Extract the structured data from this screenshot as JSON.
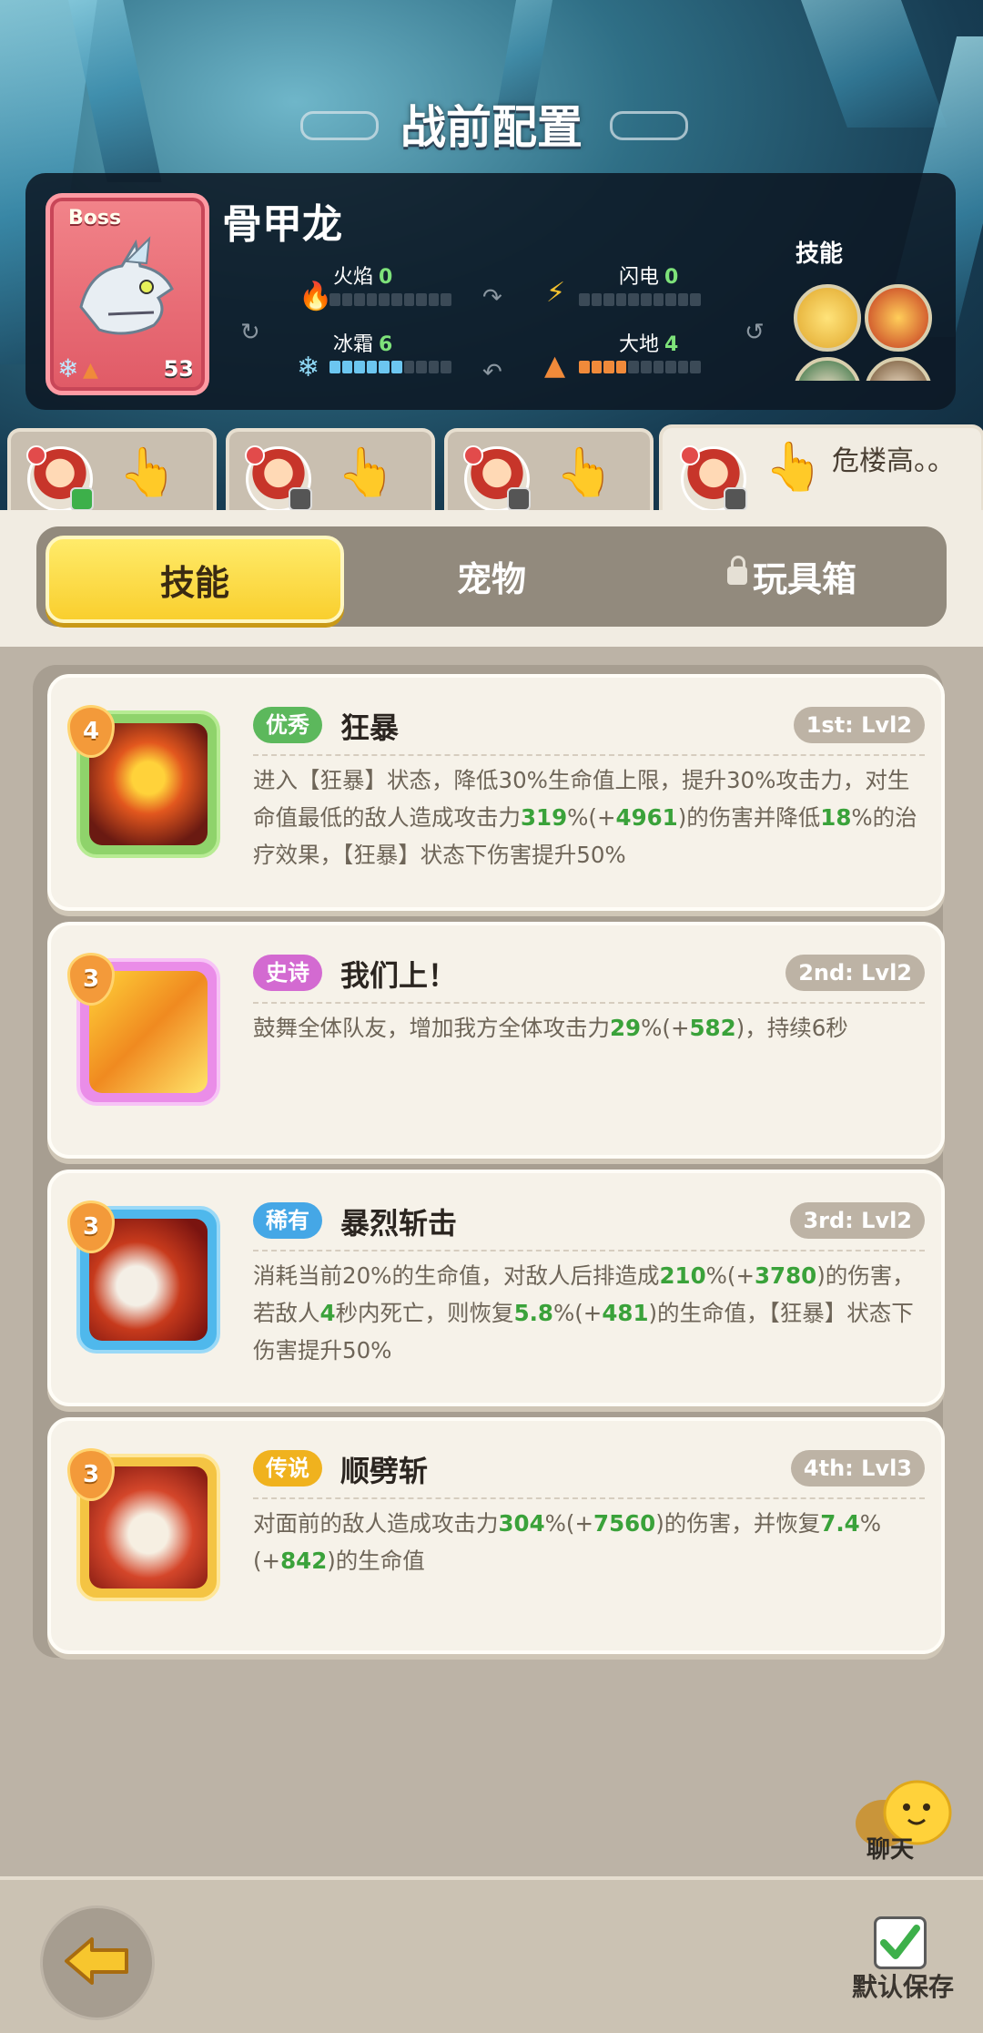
{
  "header": {
    "title": "战前配置"
  },
  "boss": {
    "tag": "Boss",
    "name": "骨甲龙",
    "level": "53",
    "stats": [
      {
        "label": "火焰",
        "value": "0"
      },
      {
        "label": "闪电",
        "value": "0"
      },
      {
        "label": "冰霜",
        "value": "6"
      },
      {
        "label": "大地",
        "value": "4"
      }
    ],
    "skills_label": "技能"
  },
  "team_tabs": [
    {
      "name": ""
    },
    {
      "name": ""
    },
    {
      "name": ""
    },
    {
      "name": "危楼高。。"
    }
  ],
  "segments": {
    "skills": "技能",
    "pets": "宠物",
    "toybox": "玩具箱"
  },
  "skills": [
    {
      "level": "4",
      "rarity": "优秀",
      "name": "狂暴",
      "rank": "1st: Lvl2",
      "desc": [
        "进入【狂暴】状态，降低30%生命值上限，提升30%攻击力，对生命值最低的敌人造成攻击力",
        "319",
        "%(+",
        "4961",
        ")的伤害并降低",
        "18",
        "%的治疗效果，【狂暴】状态下伤害提升50%"
      ]
    },
    {
      "level": "3",
      "rarity": "史诗",
      "name": "我们上！",
      "rank": "2nd: Lvl2",
      "desc": [
        "鼓舞全体队友，增加我方全体攻击力",
        "29",
        "%(+",
        "582",
        ")，持续6秒"
      ]
    },
    {
      "level": "3",
      "rarity": "稀有",
      "name": "暴烈斩击",
      "rank": "3rd: Lvl2",
      "desc": [
        "消耗当前20%的生命值，对敌人后排造成",
        "210",
        "%(+",
        "3780",
        ")的伤害，若敌人",
        "4",
        "秒内死亡，则恢复",
        "5.8",
        "%(+",
        "481",
        ")的生命值，【狂暴】状态下伤害提升50%"
      ]
    },
    {
      "level": "3",
      "rarity": "传说",
      "name": "顺劈斩",
      "rank": "4th: Lvl3",
      "desc": [
        "对面前的敌人造成攻击力",
        "304",
        "%(+",
        "7560",
        ")的伤害，并恢复",
        "7.4",
        "%(+",
        "842",
        ")的生命值"
      ]
    }
  ],
  "bottom": {
    "chat": "聊天",
    "save": "默认保存"
  },
  "colors": {
    "rarity_excellent": "#5cb85c",
    "rarity_epic": "#d36ad1",
    "rarity_rare": "#45a7e6",
    "rarity_legend": "#f0b21e",
    "value_green": "#3aa23a"
  }
}
